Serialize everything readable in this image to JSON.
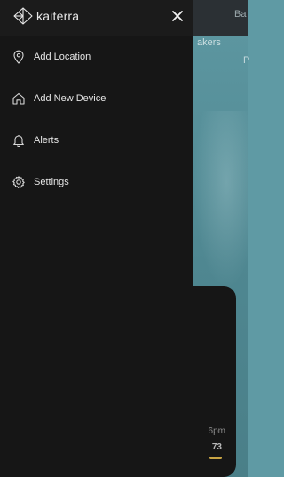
{
  "background": {
    "corner_text": "Ba",
    "faint_text": "akers",
    "faint_text2": "P",
    "card_time": "6pm",
    "card_value": "73",
    "accent_color": "#c9a545"
  },
  "drawer": {
    "brand": "kaiterra",
    "items": [
      {
        "label": "Add Location",
        "icon": "location-pin-icon"
      },
      {
        "label": "Add New Device",
        "icon": "home-icon"
      },
      {
        "label": "Alerts",
        "icon": "bell-icon"
      },
      {
        "label": "Settings",
        "icon": "gear-icon"
      }
    ]
  }
}
